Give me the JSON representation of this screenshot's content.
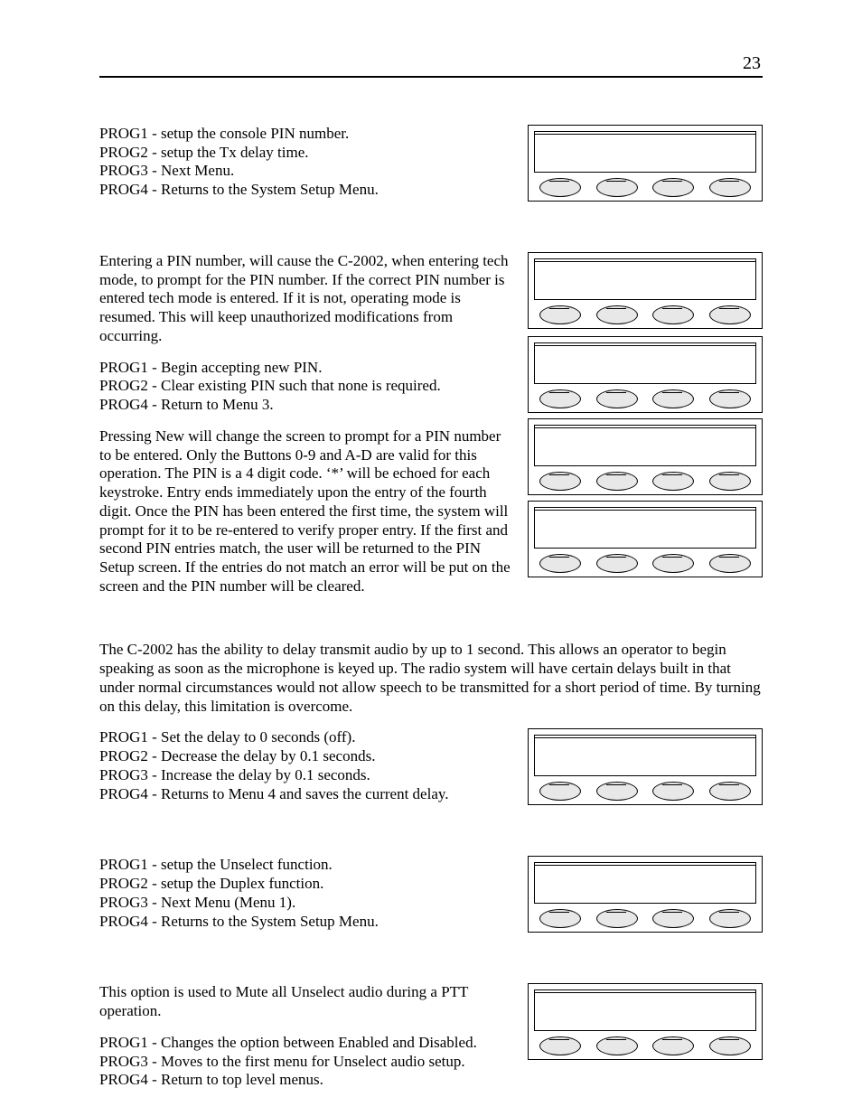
{
  "page_number": "23",
  "section1": {
    "lines": [
      "PROG1 - setup the console PIN number.",
      "PROG2 - setup the Tx delay time.",
      "PROG3 - Next Menu.",
      "PROG4 - Returns to the System Setup Menu."
    ]
  },
  "section2": {
    "para1": "Entering a PIN number, will cause the C-2002, when entering tech mode, to prompt for the PIN number.  If the correct PIN number is entered tech mode is entered.  If it is not, operating mode is resumed.  This will keep unauthorized modifications from occurring.",
    "lines": [
      "PROG1 - Begin accepting new PIN.",
      "PROG2 - Clear existing PIN such that none is required.",
      "PROG4 - Return to Menu 3."
    ],
    "para2": "Pressing New will change the screen to prompt for a PIN number to be entered.  Only the Buttons 0-9 and A-D are valid for this operation.  The PIN is a 4 digit code.  ‘*’ will be echoed for each keystroke.  Entry ends immediately upon the entry of the fourth digit.  Once the PIN has been entered the first time, the system will prompt for it to be re-entered to verify proper entry.  If the first and second PIN entries match, the user will be returned to the PIN Setup screen.  If the entries do not match an error will be put on the screen and the PIN number will be cleared."
  },
  "section3": {
    "full_para": "The C-2002 has the ability to delay transmit audio by up to 1 second.  This allows an operator to begin speaking as soon as the microphone is keyed up.  The radio system will have certain delays built in that under normal circumstances would not allow speech to be transmitted for a short period of time.  By turning on this delay, this limitation is overcome.",
    "lines": [
      "PROG1 - Set the delay to 0 seconds (off).",
      "PROG2 - Decrease the delay by 0.1 seconds.",
      "PROG3 - Increase the delay by 0.1 seconds.",
      "PROG4 - Returns to Menu 4 and saves the current delay."
    ]
  },
  "section4": {
    "lines": [
      "PROG1 - setup the Unselect function.",
      "PROG2 - setup the Duplex function.",
      "PROG3 - Next Menu (Menu 1).",
      "PROG4 - Returns to the System Setup Menu."
    ]
  },
  "section5": {
    "para": "This option is used to Mute all Unselect audio during a PTT operation.",
    "lines": [
      "PROG1 - Changes the option between Enabled and Disabled.",
      "PROG3 - Moves to the first menu for Unselect audio setup.",
      "PROG4 - Return to top level menus."
    ]
  }
}
